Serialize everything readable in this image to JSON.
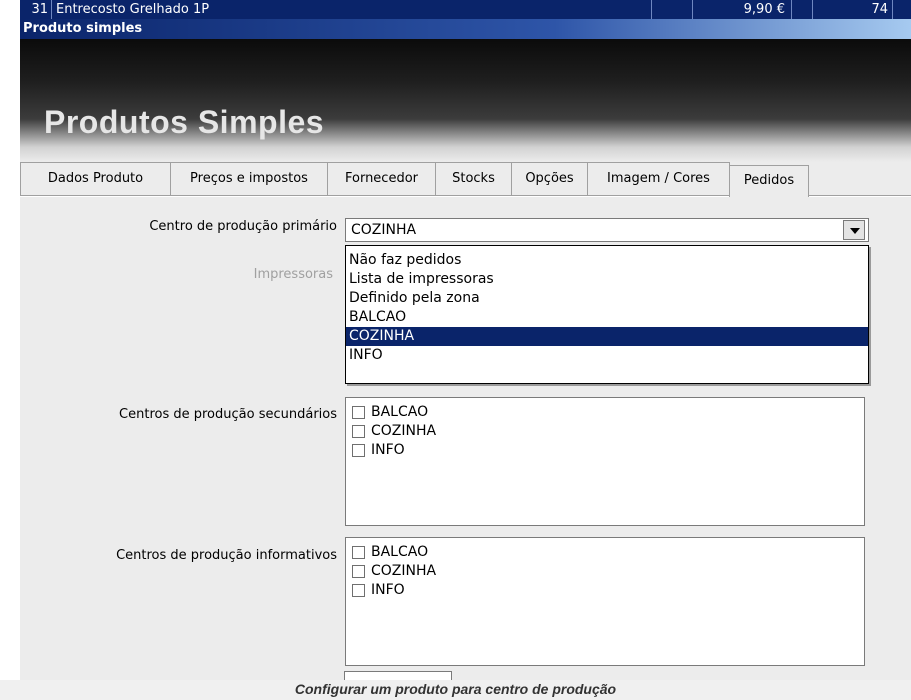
{
  "grid_row": {
    "number": "31",
    "name": "Entrecosto Grelhado 1P",
    "price": "9,90 €",
    "stock": "74"
  },
  "window_title": "Produto simples",
  "header_title": "Produtos Simples",
  "tabs": [
    {
      "label": "Dados Produto"
    },
    {
      "label": "Preços e impostos"
    },
    {
      "label": "Fornecedor"
    },
    {
      "label": "Stocks"
    },
    {
      "label": "Opções"
    },
    {
      "label": "Imagem / Cores"
    },
    {
      "label": "Pedidos",
      "active": true
    }
  ],
  "form": {
    "primary_label": "Centro de produção primário",
    "primary_value": "COZINHA",
    "printers_label": "Impressoras",
    "dropdown_options": [
      "Não faz pedidos",
      "Lista de impressoras",
      "Definido pela zona",
      "BALCAO",
      "COZINHA",
      "INFO"
    ],
    "dropdown_selected": "COZINHA",
    "secondary_label": "Centros de produção secundários",
    "secondary_items": [
      "BALCAO",
      "COZINHA",
      "INFO"
    ],
    "informative_label": "Centros de produção informativos",
    "informative_items": [
      "BALCAO",
      "COZINHA",
      "INFO"
    ]
  },
  "caption": "Configurar um produto para centro de produção",
  "colors": {
    "selection": "#0a246a",
    "panel_bg": "#ececec"
  }
}
